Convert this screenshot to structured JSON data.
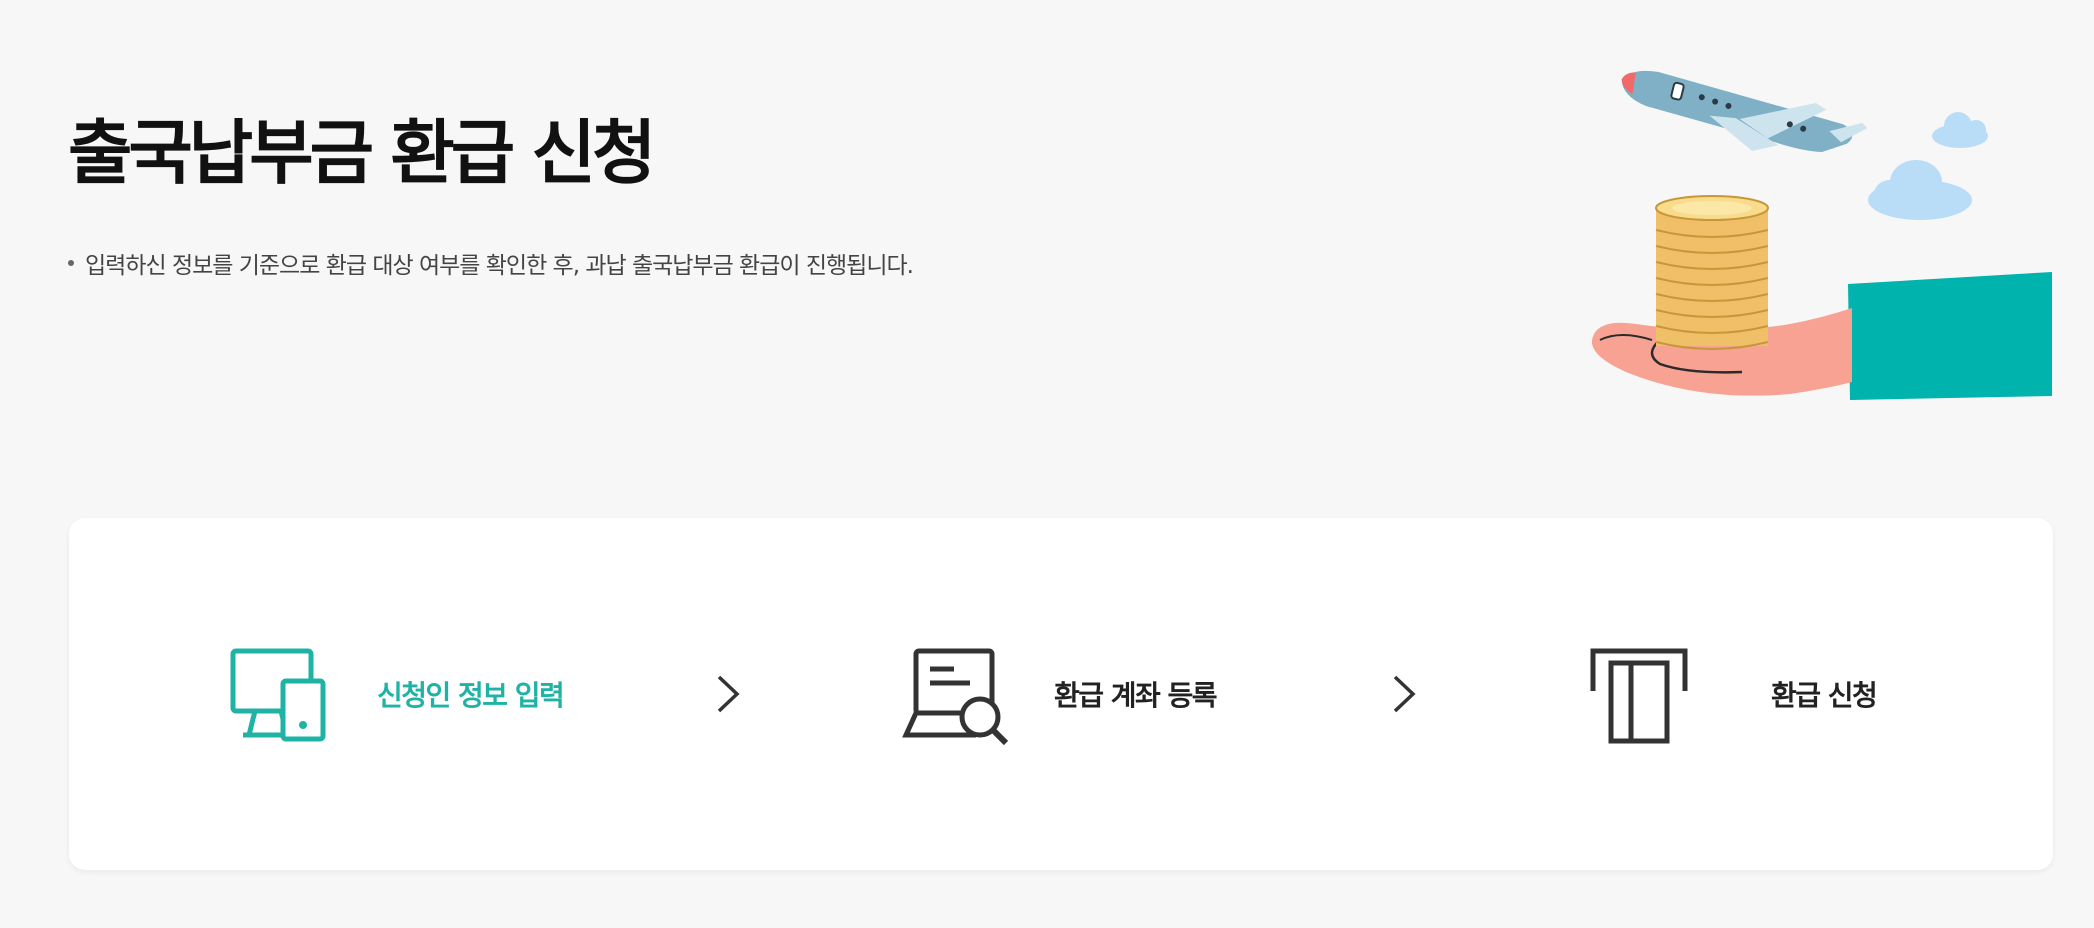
{
  "header": {
    "title": "출국납부금 환급 신청",
    "notice": "입력하신 정보를 기준으로 환급 대상 여부를 확인한 후, 과납 출국납부금 환급이 진행됩니다."
  },
  "hero": {
    "icon": "airplane-coins-hand-illustration"
  },
  "steps": [
    {
      "label": "신청인 정보 입력",
      "icon": "devices-icon",
      "active": true
    },
    {
      "label": "환급 계좌 등록",
      "icon": "laptop-search-icon",
      "active": false
    },
    {
      "label": "환급 신청",
      "icon": "atm-card-slot-icon",
      "active": false
    }
  ],
  "colors": {
    "accent": "#1fb3a5",
    "background": "#f7f7f7",
    "card": "#ffffff",
    "text": "#222222",
    "sleeve": "#00b3ad",
    "hand": "#f7a293",
    "coin": "#f0c068",
    "plane": "#7fb0c5"
  }
}
